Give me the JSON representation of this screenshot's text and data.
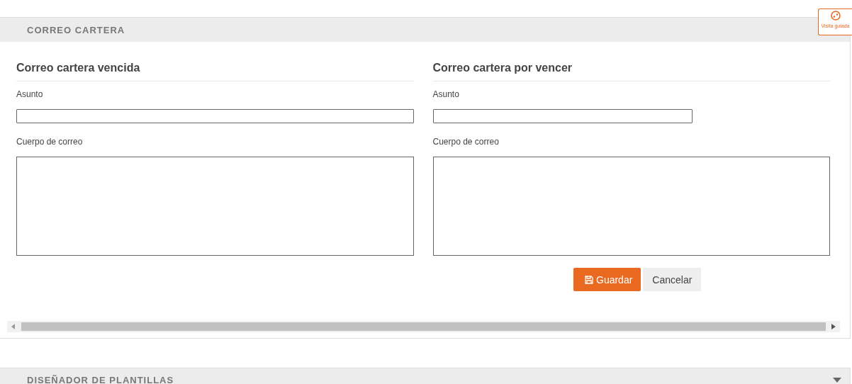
{
  "tour_button": {
    "label": "Visita guiada"
  },
  "panel": {
    "title": "CORREO CARTERA",
    "columns": [
      {
        "heading": "Correo cartera vencida",
        "subject_label": "Asunto",
        "subject_wide": true,
        "body_label": "Cuerpo de correo"
      },
      {
        "heading": "Correo cartera por vencer",
        "subject_label": "Asunto",
        "subject_wide": false,
        "body_label": "Cuerpo de correo"
      }
    ],
    "buttons": [
      {
        "label": "Guardar",
        "kind": "primary"
      },
      {
        "label": "Cancelar",
        "kind": "secondary"
      }
    ]
  },
  "collapsed_panel": {
    "title": "DISEÑADOR DE PLANTILLAS",
    "expanded": false
  }
}
